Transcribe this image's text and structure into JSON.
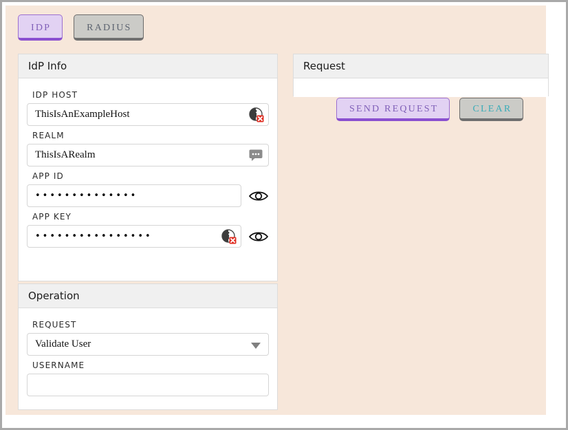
{
  "tabs": [
    {
      "id": "idp",
      "label": "IDP",
      "state": "active"
    },
    {
      "id": "radius",
      "label": "RADIUS",
      "state": "inactive"
    }
  ],
  "idp_info": {
    "title": "IdP Info",
    "fields": [
      {
        "label": "IDP HOST",
        "value": "ThisIsAnExampleHost",
        "type": "text",
        "inline_icon": "error-info-icon",
        "trailing_icon": null
      },
      {
        "label": "REALM",
        "value": "ThisIsARealm",
        "type": "text",
        "inline_icon": "tooltip-bubble-icon",
        "trailing_icon": null
      },
      {
        "label": "APP ID",
        "value": "••••••••••••••",
        "type": "password",
        "inline_icon": null,
        "trailing_icon": "eye-icon"
      },
      {
        "label": "APP KEY",
        "value": "••••••••••••••••",
        "type": "password",
        "inline_icon": "error-info-icon",
        "trailing_icon": "eye-icon"
      }
    ]
  },
  "operation": {
    "title": "Operation",
    "request_label": "REQUEST",
    "request_value": "Validate User",
    "username_label": "USERNAME",
    "username_value": "",
    "username_placeholder": ""
  },
  "request_panel": {
    "title": "Request",
    "body_text": ""
  },
  "actions": [
    {
      "id": "send",
      "label": "SEND REQUEST"
    },
    {
      "id": "clear",
      "label": "CLEAR"
    }
  ],
  "colors": {
    "page_background": "#f7e7da",
    "accent_purple": "#8a4fd0",
    "purple_fill": "#e2d2f3",
    "purple_text": "#8060b8",
    "gray_fill": "#cbcbc7",
    "gray_border": "#6b6b6b",
    "clear_text_teal": "#3aacb8",
    "card_header": "#f0f0f0",
    "error_red": "#e03024",
    "outer_border": "#a9a9a9"
  }
}
